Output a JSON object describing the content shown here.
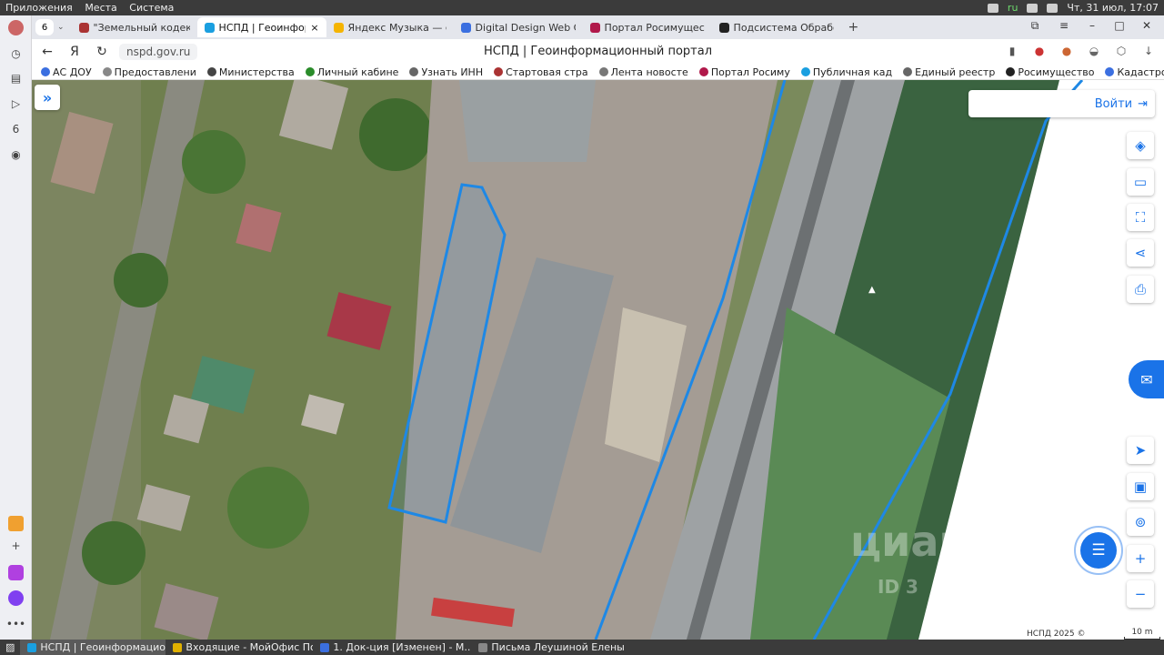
{
  "system_bar": {
    "menus": [
      "Приложения",
      "Места",
      "Система"
    ],
    "lang": "ru",
    "clock": "Чт, 31 июл, 17:07"
  },
  "tabs": {
    "count": "6",
    "items": [
      {
        "label": "\"Земельный кодекс Ро",
        "color": "#a33"
      },
      {
        "label": "НСПД | Геоинформа",
        "color": "#1a9fe0",
        "active": true
      },
      {
        "label": "Яндекс Музыка — соб",
        "color": "#f5b400"
      },
      {
        "label": "Digital Design Web Clie",
        "color": "#3b6fe0"
      },
      {
        "label": "Портал Росимуществ",
        "color": "#b0184a"
      },
      {
        "label": "Подсистема Обработк",
        "color": "#222"
      }
    ],
    "close_glyph": "×",
    "new_tab_glyph": "+"
  },
  "navbar": {
    "url": "nspd.gov.ru",
    "title": "НСПД | Геоинформационный портал"
  },
  "bookmarks": [
    {
      "label": "АС ДОУ",
      "color": "#3b6fe0"
    },
    {
      "label": "Предоставлени",
      "color": "#888"
    },
    {
      "label": "Министерства",
      "color": "#444"
    },
    {
      "label": "Личный кабине",
      "color": "#2a8c2a"
    },
    {
      "label": "Узнать ИНН",
      "color": "#666"
    },
    {
      "label": "Стартовая стра",
      "color": "#a33"
    },
    {
      "label": "Лента новосте",
      "color": "#777"
    },
    {
      "label": "Портал Росиму",
      "color": "#b0184a"
    },
    {
      "label": "Публичная кад",
      "color": "#1a9fe0"
    },
    {
      "label": "Единый реестр",
      "color": "#666"
    },
    {
      "label": "Росимущество",
      "color": "#222"
    },
    {
      "label": "Кадастровая ка",
      "color": "#3b6fe0"
    }
  ],
  "map": {
    "login_label": "Войти",
    "footer_copyright": "НСПД 2025 ©",
    "scale_label": "10 m",
    "watermark": "циан",
    "watermark_id": "ID 3",
    "parcel_color": "#1e88e5"
  },
  "taskbar": [
    {
      "label": "НСПД | Геоинформацион...",
      "color": "#1a9fe0",
      "active": true
    },
    {
      "label": "Входящие - МойОфис По...",
      "color": "#e0b000"
    },
    {
      "label": "1. Док-ция [Изменен] - М...",
      "color": "#3b6fe0"
    },
    {
      "label": "Письма Леушиной Елены",
      "color": "#888"
    }
  ]
}
